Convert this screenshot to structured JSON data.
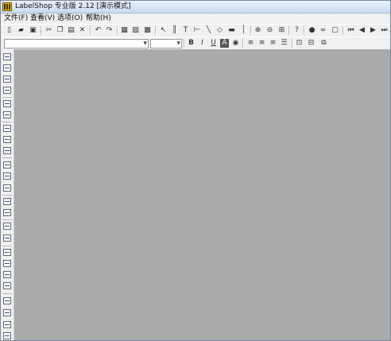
{
  "window": {
    "title": "LabelShop 专业版 2.12 [演示模式]"
  },
  "menubar": {
    "items": [
      "文件(F)",
      "查看(V)",
      "选项(O)",
      "帮助(H)"
    ]
  },
  "icons": {
    "app": "labelshop-app-icon",
    "toolbar1": [
      "new-file-icon",
      "open-folder-icon",
      "save-icon",
      "cut-icon",
      "copy-icon",
      "paste-icon",
      "delete-icon",
      "undo-icon",
      "redo-icon",
      "label-setup-icon",
      "print-preview-icon",
      "print-icon",
      "select-arrow-icon",
      "barcode-icon",
      "text-icon",
      "line-icon",
      "diagonal-line-icon",
      "shape-icon",
      "image-icon",
      "vertical-line-icon",
      "zoom-in-icon",
      "zoom-out-icon",
      "zoom-fit-icon",
      "help-icon",
      "database-icon",
      "binoculars-icon",
      "counter-icon",
      "first-record-icon",
      "prev-record-icon",
      "next-record-icon",
      "last-record-icon"
    ],
    "toolbar2": [
      "bold-icon",
      "italic-icon",
      "underline-icon",
      "font-color-icon",
      "font-effect-icon",
      "align-left-icon",
      "align-center-icon",
      "align-right-icon",
      "justify-icon",
      "group-icon",
      "ungroup-icon",
      "arrange-icon"
    ]
  }
}
